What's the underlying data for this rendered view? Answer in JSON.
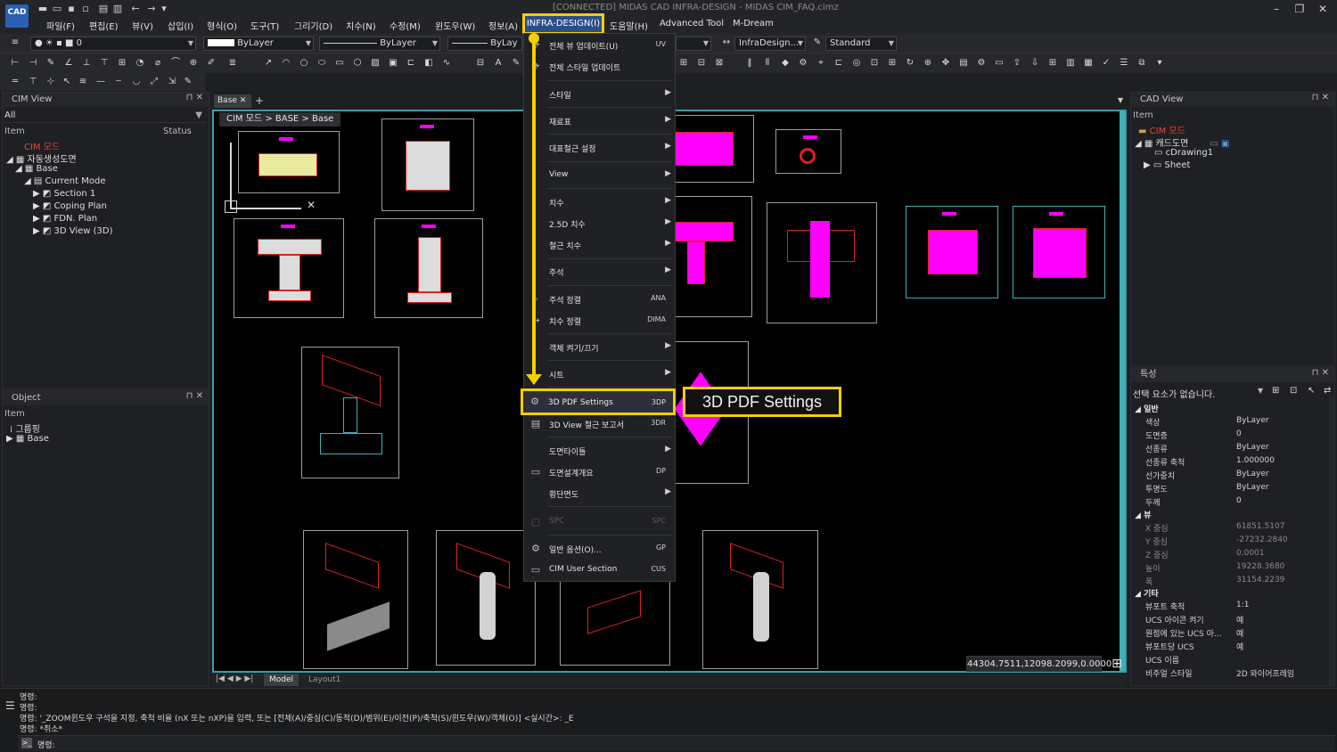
{
  "window": {
    "title": "[CONNECTED] MIDAS CAD INFRA-DESIGN - MIDAS CIM_FAQ.cimz",
    "logo": "CAD",
    "controls": [
      "minimize-icon",
      "restore-icon",
      "close-icon"
    ]
  },
  "menubar": {
    "items": [
      "파일(F)",
      "편집(E)",
      "뷰(V)",
      "삽입(I)",
      "형식(O)",
      "도구(T)",
      "그리기(D)",
      "치수(N)",
      "수정(M)",
      "윈도우(W)",
      "정보(A)",
      "INFRA-DESIGN(I)",
      "도움말(H)",
      "Advanced Tool",
      "M-Dream"
    ],
    "highlight_color": "#f2d000"
  },
  "toolbar": {
    "layer_value": "0",
    "color_value": "ByLayer",
    "linetype_value": "ByLayer",
    "lineweight_value": "ByLay",
    "style_value": "InfraDesign...",
    "standard_value": "Standard"
  },
  "cim_view": {
    "title": "CIM View",
    "filter": "All",
    "col_item": "Item",
    "col_status": "Status",
    "tree": [
      "CIM 모드",
      "자동생성도면",
      "Base",
      "Current Mode",
      "Section 1",
      "Coping Plan",
      "FDN. Plan",
      "3D View (3D)"
    ]
  },
  "object_panel": {
    "title": "Object",
    "col_item": "Item",
    "tree": [
      "그룹핑",
      "Base"
    ]
  },
  "document": {
    "tab": "Base",
    "breadcrumb": "CIM 모드 > BASE > Base",
    "coordinates": "44304.7511,12098.2099,0.0000",
    "layout_tabs": [
      "Model",
      "Layout1"
    ]
  },
  "dropdown": {
    "items": [
      {
        "label": "전체 뷰 업데이트(U)",
        "shortcut": "UV"
      },
      {
        "label": "전체 스타일 업데이트",
        "shortcut": ""
      },
      {
        "label": "스타일",
        "shortcut": ""
      },
      {
        "label": "재료표",
        "shortcut": ""
      },
      {
        "label": "대표철근 설정",
        "shortcut": ""
      },
      {
        "label": "View",
        "shortcut": ""
      },
      {
        "label": "치수",
        "shortcut": ""
      },
      {
        "label": "2.5D 치수",
        "shortcut": ""
      },
      {
        "label": "철근 치수",
        "shortcut": ""
      },
      {
        "label": "주석",
        "shortcut": ""
      },
      {
        "label": "주석 정렬",
        "shortcut": "ANA"
      },
      {
        "label": "치수 정렬",
        "shortcut": "DIMA"
      },
      {
        "label": "객체 켜기/끄기",
        "shortcut": ""
      },
      {
        "label": "시트",
        "shortcut": ""
      },
      {
        "label": "3D PDF Settings",
        "shortcut": "3DP"
      },
      {
        "label": "3D View 철근 보고서",
        "shortcut": "3DR"
      },
      {
        "label": "도면타이틀",
        "shortcut": ""
      },
      {
        "label": "도면설계개요",
        "shortcut": "DP"
      },
      {
        "label": "횡단면도",
        "shortcut": ""
      },
      {
        "label": "SPC",
        "shortcut": "SPC"
      },
      {
        "label": "일반 옵션(O)...",
        "shortcut": "GP"
      },
      {
        "label": "CIM User Section",
        "shortcut": "CUS"
      }
    ]
  },
  "callout": {
    "text": "3D PDF Settings"
  },
  "cad_view": {
    "title": "CAD View",
    "col_item": "Item",
    "tree": [
      "CIM 모드",
      "캐드도면",
      "cDrawing1",
      "Sheet"
    ]
  },
  "properties": {
    "title": "특성",
    "selection": "선택 요소가 없습니다.",
    "sections": {
      "general": "일반",
      "view": "뷰",
      "misc": "기타"
    },
    "general": [
      [
        "색상",
        "ByLayer"
      ],
      [
        "도면층",
        "0"
      ],
      [
        "선종류",
        "ByLayer"
      ],
      [
        "선종류 축척",
        "1.000000"
      ],
      [
        "선가중치",
        "ByLayer"
      ],
      [
        "투명도",
        "ByLayer"
      ],
      [
        "두께",
        "0"
      ]
    ],
    "view": [
      [
        "X 중심",
        "61851.5107"
      ],
      [
        "Y 중심",
        "-27232.2840"
      ],
      [
        "Z 중심",
        "0.0001"
      ],
      [
        "높이",
        "19228.3680"
      ],
      [
        "폭",
        "31154.2239"
      ]
    ],
    "misc": [
      [
        "뷰포트 축척",
        "1:1"
      ],
      [
        "UCS 아이콘 켜기",
        "예"
      ],
      [
        "원점에 있는 UCS 아...",
        "예"
      ],
      [
        "뷰포트당 UCS",
        "예"
      ],
      [
        "UCS 이름",
        ""
      ],
      [
        "비주얼 스타일",
        "2D 와이어프레임"
      ]
    ]
  },
  "command": {
    "lines": [
      "명령:",
      "명령:",
      "명령: '_ZOOM윈도우 구석을 지정, 축척 비율 (nX 또는 nXP)을 입력, 또는 [전체(A)/중심(C)/동적(D)/범위(E)/이전(P)/축척(S)/윈도우(W)/객체(O)] <실시간>: _E",
      "명령: *취소*"
    ],
    "prompt": "명령:"
  }
}
